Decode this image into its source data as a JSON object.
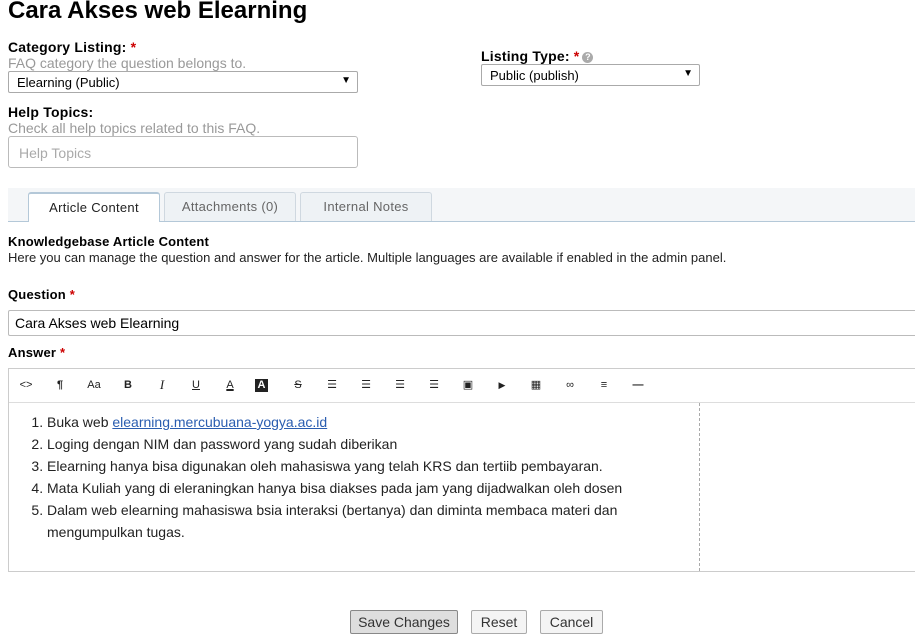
{
  "page": {
    "title": "Cara Akses web Elearning"
  },
  "category": {
    "label": "Category Listing",
    "required": "*",
    "hint": "FAQ category the question belongs to.",
    "selected": "Elearning (Public)"
  },
  "listing_type": {
    "label": "Listing Type",
    "required": "*",
    "selected": "Public (publish)"
  },
  "help_topics": {
    "label": "Help Topics",
    "hint": "Check all help topics related to this FAQ.",
    "placeholder": "Help Topics"
  },
  "tabs": [
    {
      "label": "Article Content",
      "active": true
    },
    {
      "label": "Attachments (0)",
      "active": false
    },
    {
      "label": "Internal Notes",
      "active": false
    }
  ],
  "kb": {
    "heading": "Knowledgebase Article Content",
    "description": "Here you can manage the question and answer for the article. Multiple languages are available if enabled in the admin panel."
  },
  "question": {
    "label": "Question",
    "required": "*",
    "value": "Cara Akses web Elearning"
  },
  "answer": {
    "label": "Answer",
    "required": "*",
    "toolbar": [
      {
        "name": "code-view-icon",
        "glyph": "<>"
      },
      {
        "name": "paragraph-icon",
        "glyph": "¶"
      },
      {
        "name": "font-size-icon",
        "glyph": "Aa"
      },
      {
        "name": "bold-icon",
        "glyph": "B"
      },
      {
        "name": "italic-icon",
        "glyph": "I"
      },
      {
        "name": "underline-icon",
        "glyph": "U"
      },
      {
        "name": "font-color-icon",
        "glyph": "A"
      },
      {
        "name": "background-color-icon",
        "glyph": "A"
      },
      {
        "name": "strikethrough-icon",
        "glyph": "S"
      },
      {
        "name": "unordered-list-icon",
        "glyph": "☰"
      },
      {
        "name": "ordered-list-icon",
        "glyph": "☰"
      },
      {
        "name": "outdent-icon",
        "glyph": "☰"
      },
      {
        "name": "indent-icon",
        "glyph": "☰"
      },
      {
        "name": "image-icon",
        "glyph": "▣"
      },
      {
        "name": "video-icon",
        "glyph": "▶"
      },
      {
        "name": "table-icon",
        "glyph": "▦"
      },
      {
        "name": "link-icon",
        "glyph": "∞"
      },
      {
        "name": "align-icon",
        "glyph": "≡"
      },
      {
        "name": "horizontal-rule-icon",
        "glyph": "—"
      }
    ],
    "items": [
      {
        "prefix": "Buka web ",
        "link": "elearning.mercubuana-yogya.ac.id"
      },
      {
        "text": "Loging dengan NIM dan password yang sudah diberikan"
      },
      {
        "text": "Elearning hanya bisa digunakan oleh mahasiswa yang telah KRS dan tertiib pembayaran."
      },
      {
        "text": "Mata Kuliah yang di eleraningkan hanya bisa diakses pada jam yang dijadwalkan oleh dosen"
      },
      {
        "text": "Dalam web elearning mahasiswa bsia interaksi (bertanya) dan diminta membaca materi dan mengumpulkan tugas."
      }
    ]
  },
  "buttons": {
    "save": "Save Changes",
    "reset": "Reset",
    "cancel": "Cancel"
  },
  "colors": {
    "required": "#cc0000",
    "link": "#2a5db0",
    "tab_border": "#b4c8d8"
  }
}
